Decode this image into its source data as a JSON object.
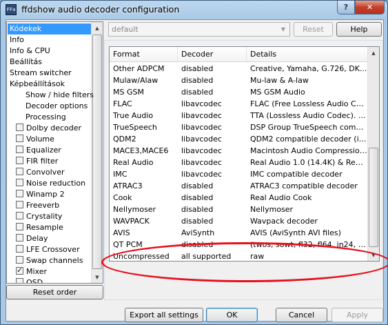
{
  "window": {
    "title": "ffdshow audio decoder configuration",
    "app_icon_text": "FFa"
  },
  "caption": {
    "help": "?",
    "close": "✕"
  },
  "tree": {
    "items": [
      {
        "label": "Kódekek",
        "selected": true
      },
      {
        "label": "Info"
      },
      {
        "label": "Info & CPU"
      },
      {
        "label": "Beállítás"
      },
      {
        "label": "Stream switcher"
      },
      {
        "label": "Képbeállítások"
      },
      {
        "label": "Show / hide filters",
        "indent": 2
      },
      {
        "label": "Decoder options",
        "indent": 2
      },
      {
        "label": "Processing",
        "indent": 2
      },
      {
        "label": "Dolby decoder",
        "checkbox": false
      },
      {
        "label": "Volume",
        "checkbox": false
      },
      {
        "label": "Equalizer",
        "checkbox": false
      },
      {
        "label": "FIR filter",
        "checkbox": false
      },
      {
        "label": "Convolver",
        "checkbox": false
      },
      {
        "label": "Noise reduction",
        "checkbox": false
      },
      {
        "label": "Winamp 2",
        "checkbox": false
      },
      {
        "label": "Freeverb",
        "checkbox": false
      },
      {
        "label": "Crystality",
        "checkbox": false
      },
      {
        "label": "Resample",
        "checkbox": false
      },
      {
        "label": "Delay",
        "checkbox": false
      },
      {
        "label": "LFE Crossover",
        "checkbox": false
      },
      {
        "label": "Swap channels",
        "checkbox": false
      },
      {
        "label": "Mixer",
        "checkbox": true
      },
      {
        "label": "OSD",
        "checkbox": false
      }
    ],
    "reset_order": "Reset order"
  },
  "toolbar": {
    "preset_value": "default",
    "reset": "Reset",
    "help": "Help"
  },
  "grid": {
    "headers": [
      "Format",
      "Decoder",
      "Details"
    ],
    "rows": [
      [
        "Other ADPCM",
        "disabled",
        "Creative, Yamaha, G.726, DK..."
      ],
      [
        "Mulaw/Alaw",
        "disabled",
        "Mu-law & A-law"
      ],
      [
        "MS GSM",
        "disabled",
        "MS GSM Audio"
      ],
      [
        "FLAC",
        "libavcodec",
        "FLAC (Free Lossless Audio Co..."
      ],
      [
        "True Audio",
        "libavcodec",
        "TTA (Lossless Audio Codec). ..."
      ],
      [
        "TrueSpeech",
        "libavcodec",
        "DSP Group TrueSpeech comp..."
      ],
      [
        "QDM2",
        "libavcodec",
        "QDM2 compatible decoder (in..."
      ],
      [
        "MACE3,MACE6",
        "libavcodec",
        "Macintosh Audio Compression..."
      ],
      [
        "Real Audio",
        "libavcodec",
        "Real Audio 1.0 (14.4K) & Real..."
      ],
      [
        "IMC",
        "libavcodec",
        "IMC compatible decoder"
      ],
      [
        "ATRAC3",
        "disabled",
        "ATRAC3 compatible decoder"
      ],
      [
        "Cook",
        "disabled",
        "Real Audio Cook"
      ],
      [
        "Nellymoser",
        "disabled",
        "Nellymoser"
      ],
      [
        "WAVPACK",
        "disabled",
        "Wavpack decoder"
      ],
      [
        "AVIS",
        "AviSynth",
        "AVIS (AviSynth AVI files)"
      ],
      [
        "QT PCM",
        "disabled",
        "(twos, sowt, fl32, fl64, in24, in..."
      ],
      [
        "Uncompressed",
        "all supported",
        "raw"
      ]
    ]
  },
  "buttons": {
    "export": "Export all settings",
    "ok": "OK",
    "cancel": "Cancel",
    "apply": "Apply"
  },
  "colors": {
    "selection": "#3399ff",
    "highlight_ellipse": "#e8101c"
  }
}
